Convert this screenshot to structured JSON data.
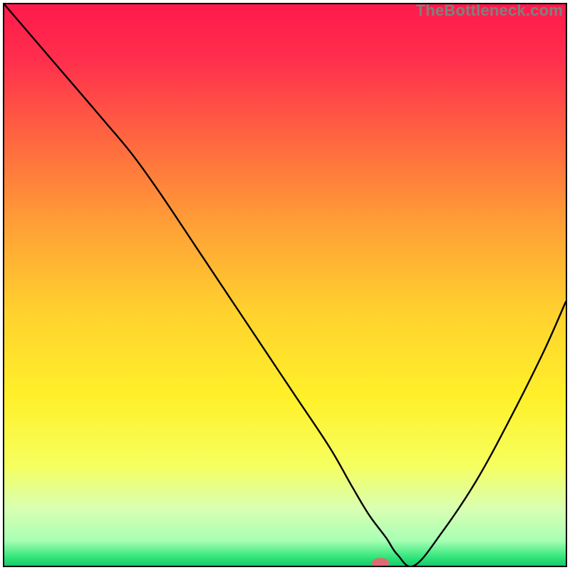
{
  "watermark": "TheBottleneck.com",
  "chart_data": {
    "type": "line",
    "title": "",
    "xlabel": "",
    "ylabel": "",
    "xlim": [
      0,
      100
    ],
    "ylim": [
      0,
      100
    ],
    "axes_visible": false,
    "grid": false,
    "gradient": {
      "stops": [
        {
          "offset": 0.0,
          "color": "#ff1a4b"
        },
        {
          "offset": 0.1,
          "color": "#ff2f4d"
        },
        {
          "offset": 0.25,
          "color": "#ff6a3f"
        },
        {
          "offset": 0.4,
          "color": "#ffa236"
        },
        {
          "offset": 0.55,
          "color": "#ffd22e"
        },
        {
          "offset": 0.7,
          "color": "#fff02a"
        },
        {
          "offset": 0.82,
          "color": "#f6ff5e"
        },
        {
          "offset": 0.9,
          "color": "#d8ffb3"
        },
        {
          "offset": 0.955,
          "color": "#a8ffb4"
        },
        {
          "offset": 0.985,
          "color": "#30e57a"
        },
        {
          "offset": 1.0,
          "color": "#18c96a"
        }
      ]
    },
    "series": [
      {
        "name": "bottleneck-curve",
        "x": [
          0,
          6,
          12,
          18,
          23,
          28,
          34,
          40,
          46,
          52,
          58,
          62,
          65,
          68,
          70,
          73,
          78,
          84,
          90,
          96,
          100
        ],
        "y": [
          100,
          93,
          86,
          79,
          73,
          66,
          57,
          48,
          39,
          30,
          21,
          14,
          9,
          5,
          2,
          0,
          6,
          15,
          26,
          38,
          47
        ]
      }
    ],
    "marker": {
      "name": "optimal-point",
      "x": 67,
      "y": 0.5,
      "color": "#e06a72",
      "rx": 12,
      "ry": 7
    },
    "border": {
      "inset": 4,
      "width": 2,
      "color": "#000000"
    }
  }
}
